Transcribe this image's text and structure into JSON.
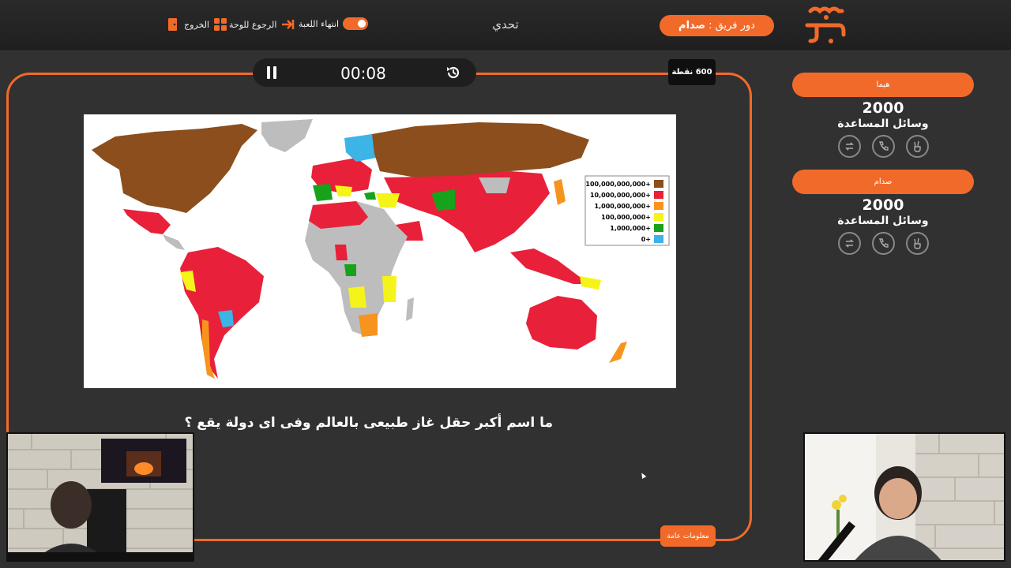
{
  "header": {
    "turn_label": "دور فريق :",
    "turn_team": "صدام",
    "challenge": "تحدي",
    "end_game": "انتهاء اللعبة",
    "back_to_board": "الرجوع للوحة",
    "exit": "الخروج",
    "logo_text": "سين جيم"
  },
  "timer": {
    "time": "00:08"
  },
  "points_badge": "600 نقطة",
  "question": {
    "text": "ما اسم أكبر حقل غاز طبيعى بالعالم وفى اى دولة يقع ؟",
    "category": "معلومات عامة"
  },
  "map_legend": [
    "100,000,000,000+",
    "10,000,000,000+",
    "1,000,000,000+",
    "100,000,000+",
    "1,000,000+",
    "0+"
  ],
  "map_legend_colors": [
    "#8b4e1c",
    "#e8203a",
    "#f7941d",
    "#f4f41a",
    "#17a21b",
    "#3cb4e5"
  ],
  "teams": [
    {
      "name": "هيما",
      "score": "2000",
      "aids_label": "وسائل المساعدة"
    },
    {
      "name": "صدام",
      "score": "2000",
      "aids_label": "وسائل المساعدة"
    }
  ],
  "colors": {
    "accent": "#f26a2a",
    "background": "#313131"
  }
}
